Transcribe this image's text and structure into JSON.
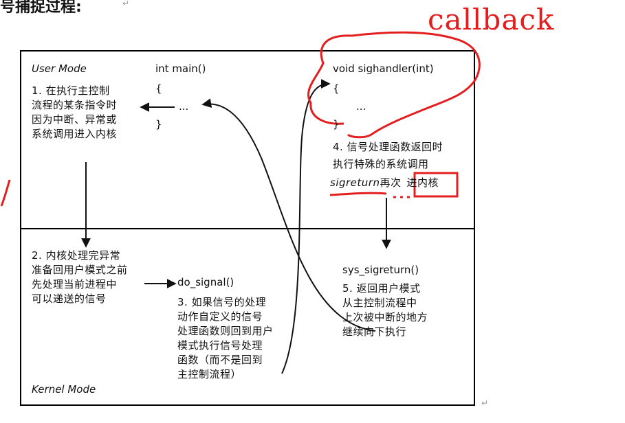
{
  "heading": {
    "text": "号捕捉过程:",
    "mark": "↵"
  },
  "annotation": {
    "callback": "callback"
  },
  "user_mode": {
    "label": "User Mode",
    "step1": [
      "1. 在执行主控制",
      "流程的某条指令时",
      "因为中断、异常或",
      "系统调用进入内核"
    ],
    "main_sig": "int main()",
    "open_brace": "{",
    "ellipsis": "...",
    "close_brace": "}",
    "handler_sig": "void sighandler(int)",
    "handler_open": "{",
    "handler_ellipsis": "...",
    "handler_close": "}",
    "step4_line1": "4. 信号处理函数返回时",
    "step4_line2": "执行特殊的系统调用",
    "step4_sigreturn": "sigreturn",
    "step4_again": "再次",
    "step4_kernel": "进内核"
  },
  "kernel_mode": {
    "label": "Kernel Mode",
    "step2": [
      "2. 内核处理完异常",
      "准备回用户模式之前",
      "先处理当前进程中",
      "可以递送的信号"
    ],
    "do_signal": "do_signal()",
    "step3": [
      "3. 如果信号的处理",
      "动作自定义的信号",
      "处理函数则回到用户",
      "模式执行信号处理",
      "函数（而不是回到",
      "主控制流程）"
    ],
    "sys_sigreturn": "sys_sigreturn()",
    "step5": [
      "5. 返回用户模式",
      "从主控制流程中",
      "上次被中断的地方",
      "继续向下执行"
    ]
  },
  "colors": {
    "annotation": "#e41e1e",
    "line": "#111111",
    "border": "#000000"
  },
  "end_mark": "↵"
}
